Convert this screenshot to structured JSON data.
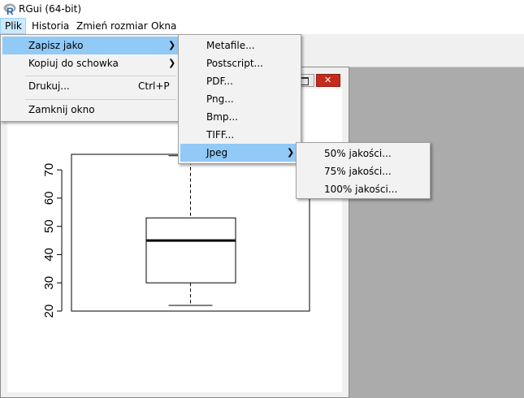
{
  "window": {
    "title": "RGui (64-bit)"
  },
  "menubar": [
    {
      "label": "Plik",
      "active": true
    },
    {
      "label": "Historia"
    },
    {
      "label": "Zmień rozmiar"
    },
    {
      "label": "Okna"
    }
  ],
  "plik_menu": {
    "items": [
      {
        "label": "Zapisz jako",
        "submenu": true,
        "highlighted": true
      },
      {
        "label": "Kopiuj do schowka",
        "submenu": true
      },
      {
        "label": "Drukuj...",
        "shortcut": "Ctrl+P"
      },
      {
        "label": "Zamknij okno"
      }
    ]
  },
  "zapisz_menu": {
    "items": [
      {
        "label": "Metafile..."
      },
      {
        "label": "Postscript..."
      },
      {
        "label": "PDF..."
      },
      {
        "label": "Png..."
      },
      {
        "label": "Bmp..."
      },
      {
        "label": "TIFF..."
      },
      {
        "label": "Jpeg",
        "submenu": true,
        "highlighted": true
      }
    ]
  },
  "jpeg_menu": {
    "items": [
      {
        "label": "50% jakości..."
      },
      {
        "label": "75% jakości..."
      },
      {
        "label": "100% jakości..."
      }
    ]
  },
  "chart_data": {
    "type": "boxplot",
    "y_ticks": [
      20,
      30,
      40,
      50,
      60,
      70
    ],
    "ylim": [
      20,
      75.5
    ],
    "box": {
      "whisker_low": 22,
      "q1": 30,
      "median": 45,
      "q3": 53,
      "whisker_high": 75
    }
  }
}
